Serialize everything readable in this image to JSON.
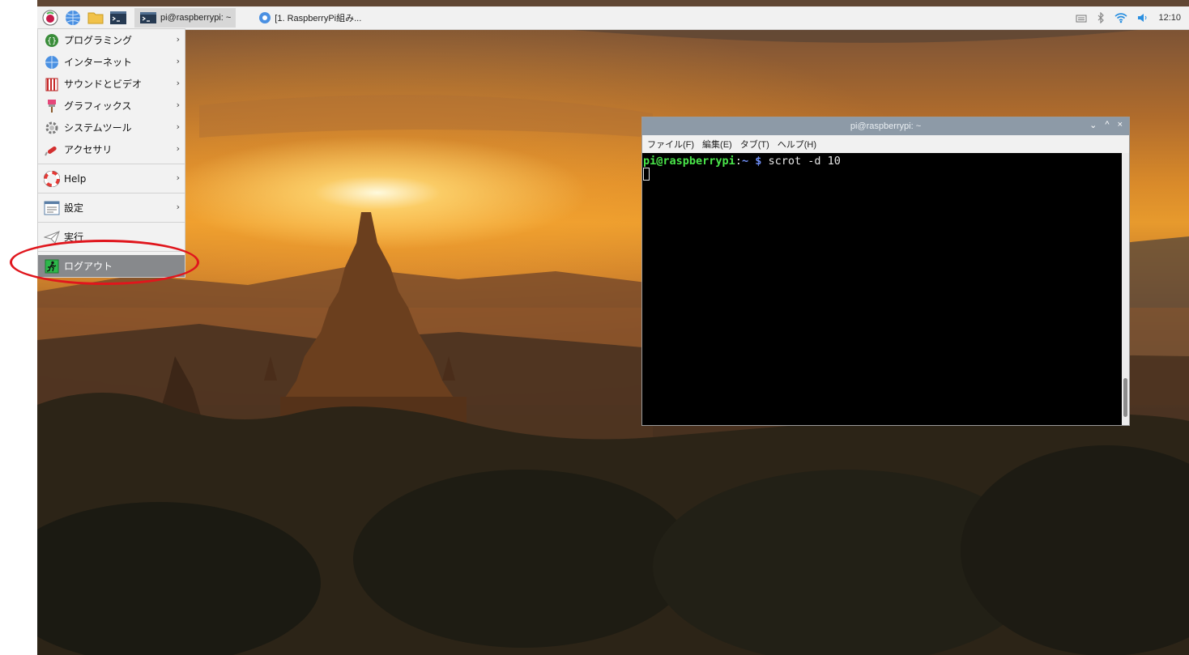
{
  "panel": {
    "tasks": [
      {
        "label": "pi@raspberrypi: ~"
      },
      {
        "label": "[1. RaspberryPi組み..."
      }
    ],
    "clock": "12:10"
  },
  "menu": {
    "items": [
      {
        "label": "プログラミング"
      },
      {
        "label": "インターネット"
      },
      {
        "label": "サウンドとビデオ"
      },
      {
        "label": "グラフィックス"
      },
      {
        "label": "システムツール"
      },
      {
        "label": "アクセサリ"
      },
      {
        "label": "Help"
      },
      {
        "label": "設定"
      },
      {
        "label": "実行"
      },
      {
        "label": "ログアウト"
      }
    ],
    "submenu_arrow": "›"
  },
  "terminal": {
    "title": "pi@raspberrypi: ~",
    "menus": [
      "ファイル(F)",
      "編集(E)",
      "タブ(T)",
      "ヘルプ(H)"
    ],
    "prompt_user": "pi@raspberrypi",
    "prompt_sep": ":",
    "prompt_path": "~ $",
    "command": " scrot -d 10",
    "ctrl_min": "⌄",
    "ctrl_max": "^",
    "ctrl_close": "×"
  },
  "colors": {
    "highlight_circle": "#e0161d",
    "menu_selected": "#87898c",
    "terminal_title": "#8d9aa7"
  }
}
